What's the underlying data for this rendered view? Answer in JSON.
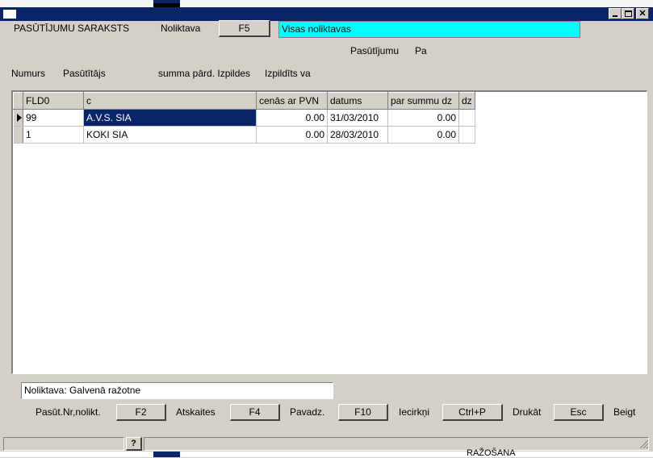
{
  "window": {
    "title": ""
  },
  "header": {
    "title": "PASŪTĪJUMU SARAKSTS",
    "warehouse_label": "Noliktava",
    "warehouse_button": "F5",
    "warehouse_value": "Visas noliktavas",
    "orders_label_1": "Pasūtījumu",
    "orders_label_2": "Pa"
  },
  "columns_row": {
    "numurs": "Numurs",
    "pasutitajs": "Pasūtītājs",
    "summa": "summa pārd. Izpildes",
    "izpildits": "Izpildīts va"
  },
  "table": {
    "headers": [
      "FLD0",
      "c",
      "cenās ar PVN",
      "datums",
      "par summu dz",
      "dz"
    ],
    "rows": [
      {
        "c0": "99",
        "c1": "A.V.S. SIA",
        "c2": "0.00",
        "c3": "31/03/2010",
        "c4": "0.00",
        "c5": ""
      },
      {
        "c0": "1",
        "c1": "KOKI SIA",
        "c2": "0.00",
        "c3": "28/03/2010",
        "c4": "0.00",
        "c5": ""
      }
    ]
  },
  "info": {
    "warehouse_text": "Noliktava: Galvenā ražotne"
  },
  "footer": {
    "pasut_label": "Pasūt.Nr,nolikt.",
    "f2": "F2",
    "atskaites_label": "Atskaites",
    "f4": "F4",
    "pavadz_label": "Pavadz.",
    "f10": "F10",
    "iecirkni_label": "Iecirkņi",
    "ctrlp": "Ctrl+P",
    "drukat_label": "Drukāt",
    "esc": "Esc",
    "beigt_label": "Beigt"
  },
  "statusbar": {
    "help": "?"
  },
  "background_text": "RAŽOŠANA",
  "colors": {
    "titlebar": "#0a246a",
    "highlight": "#00ffff",
    "selection": "#0a246a"
  }
}
